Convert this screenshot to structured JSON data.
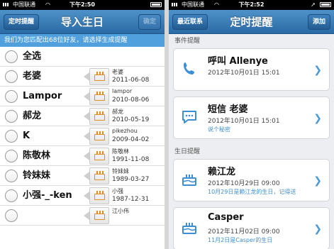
{
  "left": {
    "status": {
      "carrier": "中国联通",
      "time": "下午2:50"
    },
    "nav": {
      "left_button": "定时提醒",
      "title": "导入生日",
      "right_button": "确定"
    },
    "banner": "我们为您匹配出68位好友，请选择生成提醒",
    "select_all": "全选",
    "contacts": [
      {
        "name": "老婆",
        "birth_name": "老婆",
        "birth_date": "2011-06-08"
      },
      {
        "name": "Lampor",
        "birth_name": "lampor",
        "birth_date": "2010-08-06"
      },
      {
        "name": "郝龙",
        "birth_name": "郝龙",
        "birth_date": "2010-05-19"
      },
      {
        "name": "K",
        "birth_name": "pikezhou",
        "birth_date": "2009-04-02"
      },
      {
        "name": "陈敬林",
        "birth_name": "陈敬林",
        "birth_date": "1991-11-08"
      },
      {
        "name": "铃妹妹",
        "birth_name": "铃妹妹",
        "birth_date": "1989-03-27"
      },
      {
        "name": "小强-_-ken",
        "birth_name": "小强",
        "birth_date": "1987-12-31"
      },
      {
        "name": "",
        "birth_name": "江小伟",
        "birth_date": ""
      }
    ]
  },
  "right": {
    "status": {
      "carrier": "中国联通",
      "time": "下午2:52"
    },
    "nav": {
      "left_button": "最近联系",
      "title": "定时提醒",
      "right_button": "添加"
    },
    "section_events": "事件提醒",
    "section_birthdays": "生日提醒",
    "events": [
      {
        "icon": "phone-icon",
        "title": "呼叫 Allenye",
        "time": "2012年10月01日 15:01",
        "note": ""
      },
      {
        "icon": "sms-icon",
        "title": "短信 老婆",
        "time": "2012年10月01日 15:01",
        "note": "说个秘密"
      }
    ],
    "birthdays": [
      {
        "icon": "cake-icon",
        "title": "赖江龙",
        "time": "2012年10月29日 09:00",
        "note": "10月29日是赖江龙的生日，记得送"
      },
      {
        "icon": "cake-icon",
        "title": "Casper",
        "time": "2012年11月02日 09:00",
        "note": "11月2日是Casper的生日"
      }
    ]
  },
  "colors": {
    "nav_blue": "#2a6aa5",
    "banner_blue": "#4fa0dd",
    "accent_orange": "#e08d21",
    "link_blue": "#3f8fd0"
  }
}
